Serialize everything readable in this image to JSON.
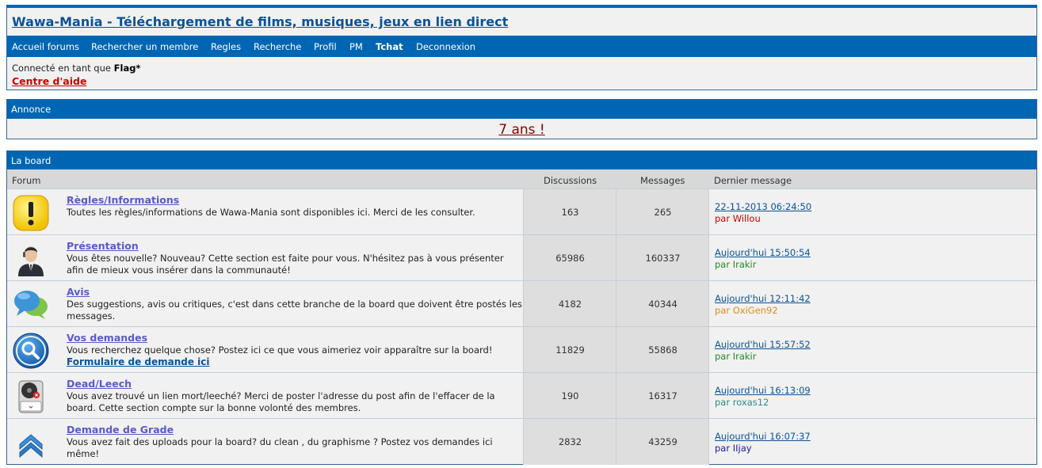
{
  "header": {
    "title": "Wawa-Mania - Téléchargement de films, musiques, jeux en lien direct",
    "nav": [
      "Accueil forums",
      "Rechercher un membre",
      "Regles",
      "Recherche",
      "Profil",
      "PM",
      "Tchat",
      "Deconnexion"
    ],
    "login_prefix": "Connecté en tant que",
    "login_user": "Flag*",
    "help_link": "Centre d'aide"
  },
  "announce": {
    "title": "Annonce",
    "message": "7 ans !"
  },
  "board": {
    "title": "La board",
    "columns": {
      "forum": "Forum",
      "topics": "Discussions",
      "posts": "Messages",
      "last": "Dernier message"
    },
    "rows": [
      {
        "icon": "warning-exclamation-icon",
        "name": "Règles/Informations",
        "desc": "Toutes les règles/informations de Wawa-Mania sont disponibles ici. Merci de les consulter.",
        "extra": "",
        "topics": "163",
        "posts": "265",
        "last_date": "22-11-2013 06:24:50",
        "last_by": "par Willou",
        "by_color": "#cc0000"
      },
      {
        "icon": "user-avatar-icon",
        "name": "Présentation",
        "desc": "Vous êtes nouvelle? Nouveau? Cette section est faite pour vous. N'hésitez pas à vous présenter afin de mieux vous insérer dans la communauté!",
        "extra": "",
        "topics": "65986",
        "posts": "160337",
        "last_date": "Aujourd'hui 15:50:54",
        "last_by": "par Irakir",
        "by_color": "#228b22"
      },
      {
        "icon": "chat-bubbles-icon",
        "name": "Avis",
        "desc": "Des suggestions, avis ou critiques, c'est dans cette branche de la board que doivent être postés les messages.",
        "extra": "",
        "topics": "4182",
        "posts": "40344",
        "last_date": "Aujourd'hui 12:11:42",
        "last_by": "par OxiGen92",
        "by_color": "#e08a1e"
      },
      {
        "icon": "magnifier-search-icon",
        "name": "Vos demandes",
        "desc": "Vous recherchez quelque chose? Postez ici ce que vous aimeriez voir apparaître sur la board!",
        "extra": "Formulaire de demande ici",
        "topics": "11829",
        "posts": "55868",
        "last_date": "Aujourd'hui 15:57:52",
        "last_by": "par Irakir",
        "by_color": "#228b22"
      },
      {
        "icon": "broken-disk-icon",
        "name": "Dead/Leech",
        "desc": "Vous avez trouvé un lien mort/leeché? Merci de poster l'adresse du post afin de l'effacer de la board. Cette section compte sur la bonne volonté des membres.",
        "extra": "",
        "topics": "190",
        "posts": "16317",
        "last_date": "Aujourd'hui 16:13:09",
        "last_by": "par roxas12",
        "by_color": "#2e8b8b"
      },
      {
        "icon": "rank-chevron-icon",
        "name": "Demande de Grade",
        "desc": "Vous avez fait des uploads pour la board? du clean , du graphisme ? Postez vos demandes ici même!",
        "extra": "",
        "topics": "2832",
        "posts": "43259",
        "last_date": "Aujourd'hui 16:07:37",
        "last_by": "par IIjay",
        "by_color": "#1a1a99"
      }
    ]
  }
}
